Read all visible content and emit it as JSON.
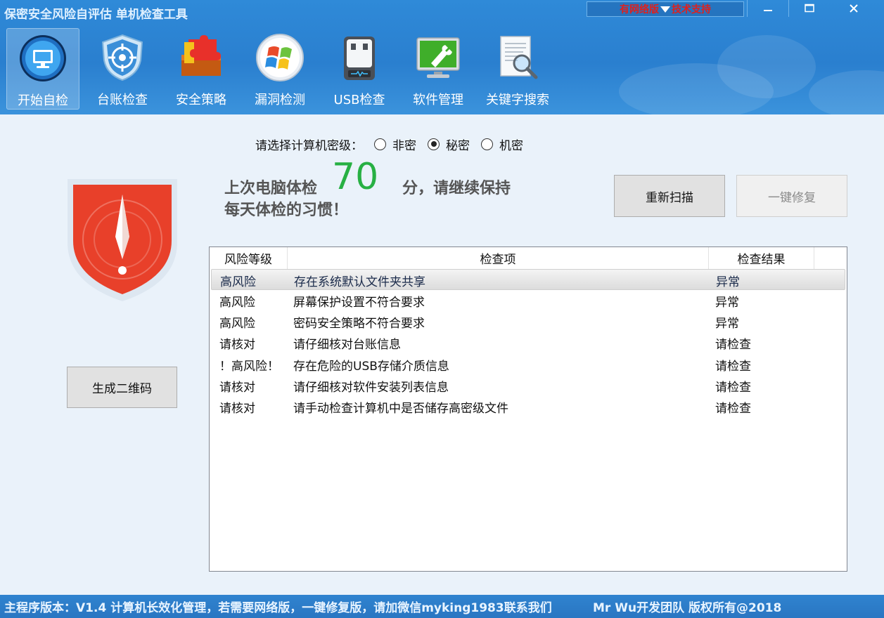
{
  "window": {
    "title": "保密安全风险自评估 单机检查工具",
    "support_left": "有网络版",
    "support_right": "技术支持"
  },
  "toolbar": [
    {
      "label": "开始自检",
      "icon": "monitor-icon",
      "active": true
    },
    {
      "label": "台账检查",
      "icon": "shield-target-icon",
      "active": false
    },
    {
      "label": "安全策略",
      "icon": "puzzle-icon",
      "active": false
    },
    {
      "label": "漏洞检测",
      "icon": "windows-orb-icon",
      "active": false
    },
    {
      "label": "USB检查",
      "icon": "usb-drive-icon",
      "active": false
    },
    {
      "label": "软件管理",
      "icon": "wrench-monitor-icon",
      "active": false
    },
    {
      "label": "关键字搜索",
      "icon": "document-search-icon",
      "active": false
    }
  ],
  "secret_level": {
    "label": "请选择计算机密级：",
    "options": [
      "非密",
      "秘密",
      "机密"
    ],
    "selected": "秘密"
  },
  "score": {
    "prefix": "上次电脑体检",
    "value": "70",
    "suffix": "分，请继续保持",
    "line2": "每天体检的习惯！"
  },
  "buttons": {
    "rescan": "重新扫描",
    "repair": "一键修复",
    "qrcode": "生成二维码"
  },
  "table": {
    "columns": [
      "风险等级",
      "检查项",
      "检查结果"
    ],
    "rows": [
      {
        "level": "高风险",
        "item": "存在系统默认文件夹共享",
        "result": "异常"
      },
      {
        "level": "高风险",
        "item": "屏幕保护设置不符合要求",
        "result": "异常"
      },
      {
        "level": "高风险",
        "item": "密码安全策略不符合要求",
        "result": "异常"
      },
      {
        "level": "请核对",
        "item": "请仔细核对台账信息",
        "result": "请检查"
      },
      {
        "level": "！高风险！",
        "item": "存在危险的USB存储介质信息",
        "result": "请检查"
      },
      {
        "level": "请核对",
        "item": "请仔细核对软件安装列表信息",
        "result": "请检查"
      },
      {
        "level": "请核对",
        "item": "请手动检查计算机中是否储存高密级文件",
        "result": "请检查"
      }
    ]
  },
  "footer": {
    "left": "主程序版本：V1.4 计算机长效化管理，若需要网络版，一键修复版，请加微信myking1983联系我们",
    "right": "Mr Wu开发团队  版权所有@2018"
  },
  "colors": {
    "accent": "#2a7fcf",
    "score": "#27b043",
    "danger": "#e8402a"
  }
}
